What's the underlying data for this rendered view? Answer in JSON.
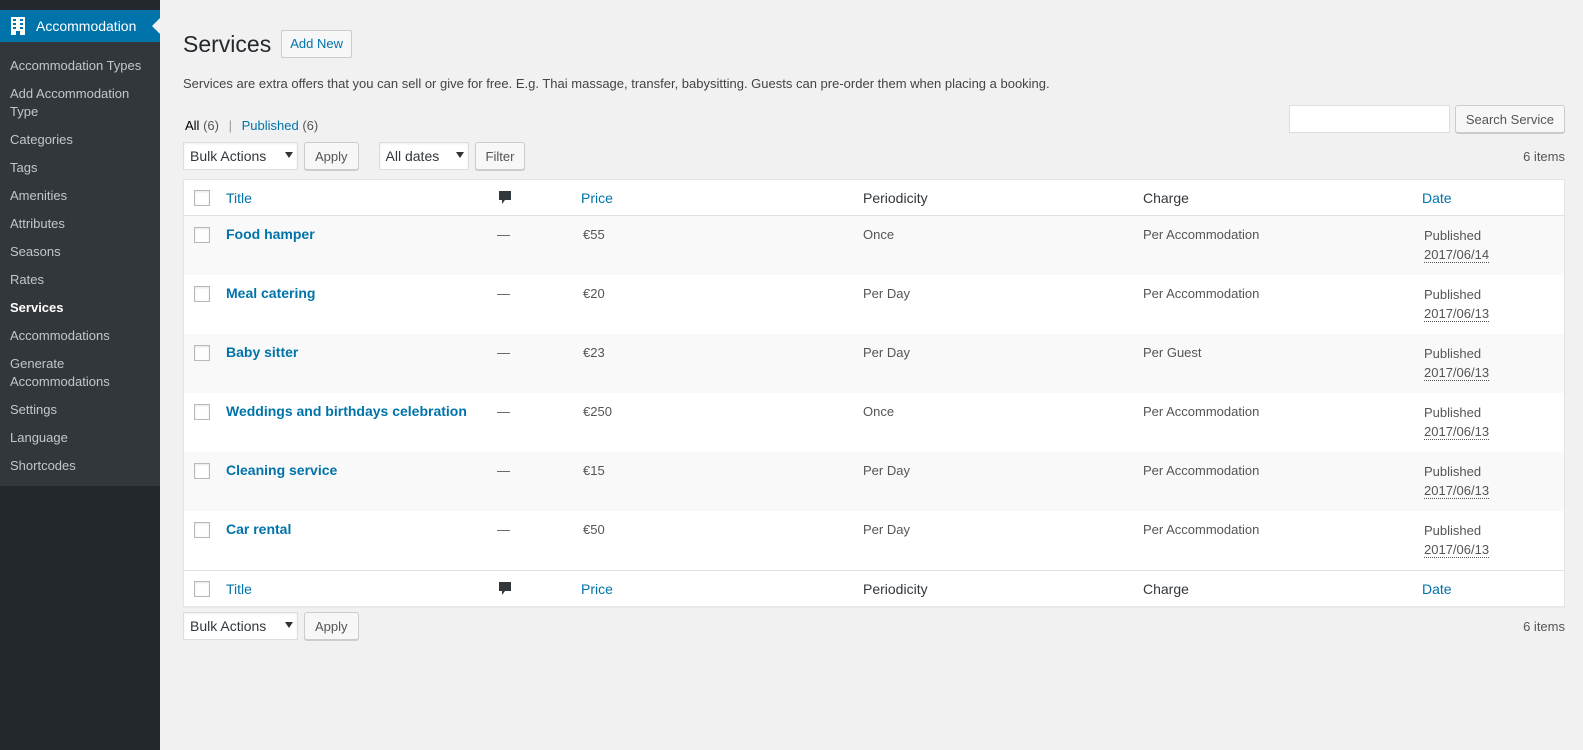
{
  "sidebar": {
    "menu_title": "Accommodation",
    "items": [
      {
        "label": "Accommodation Types",
        "current": false
      },
      {
        "label": "Add Accommodation Type",
        "current": false
      },
      {
        "label": "Categories",
        "current": false
      },
      {
        "label": "Tags",
        "current": false
      },
      {
        "label": "Amenities",
        "current": false
      },
      {
        "label": "Attributes",
        "current": false
      },
      {
        "label": "Seasons",
        "current": false
      },
      {
        "label": "Rates",
        "current": false
      },
      {
        "label": "Services",
        "current": true
      },
      {
        "label": "Accommodations",
        "current": false
      },
      {
        "label": "Generate Accommodations",
        "current": false
      },
      {
        "label": "Settings",
        "current": false
      },
      {
        "label": "Language",
        "current": false
      },
      {
        "label": "Shortcodes",
        "current": false
      }
    ]
  },
  "header": {
    "title": "Services",
    "add_new": "Add New",
    "description": "Services are extra offers that you can sell or give for free. E.g. Thai massage, transfer, babysitting. Guests can pre-order them when placing a booking."
  },
  "filters": {
    "all_label": "All",
    "all_count": "(6)",
    "separator": "|",
    "published_label": "Published",
    "published_count": "(6)"
  },
  "search": {
    "value": "",
    "button": "Search Service"
  },
  "tablenav": {
    "bulk_actions": "Bulk Actions",
    "apply": "Apply",
    "dates": "All dates",
    "filter": "Filter",
    "items_count": "6 items"
  },
  "table": {
    "columns": {
      "title": "Title",
      "comments_icon": "comment-bubble",
      "price": "Price",
      "periodicity": "Periodicity",
      "charge": "Charge",
      "date": "Date"
    },
    "rows": [
      {
        "title": "Food hamper",
        "comments": "—",
        "price": "€55",
        "periodicity": "Once",
        "charge": "Per Accommodation",
        "status": "Published",
        "date": "2017/06/14"
      },
      {
        "title": "Meal catering",
        "comments": "—",
        "price": "€20",
        "periodicity": "Per Day",
        "charge": "Per Accommodation",
        "status": "Published",
        "date": "2017/06/13"
      },
      {
        "title": "Baby sitter",
        "comments": "—",
        "price": "€23",
        "periodicity": "Per Day",
        "charge": "Per Guest",
        "status": "Published",
        "date": "2017/06/13"
      },
      {
        "title": "Weddings and birthdays celebration",
        "comments": "—",
        "price": "€250",
        "periodicity": "Once",
        "charge": "Per Accommodation",
        "status": "Published",
        "date": "2017/06/13"
      },
      {
        "title": "Cleaning service",
        "comments": "—",
        "price": "€15",
        "periodicity": "Per Day",
        "charge": "Per Accommodation",
        "status": "Published",
        "date": "2017/06/13"
      },
      {
        "title": "Car rental",
        "comments": "—",
        "price": "€50",
        "periodicity": "Per Day",
        "charge": "Per Accommodation",
        "status": "Published",
        "date": "2017/06/13"
      }
    ]
  },
  "colors": {
    "sidebar_bg": "#23282d",
    "submenu_bg": "#32373c",
    "accent": "#0073aa",
    "page_bg": "#f1f1f1"
  }
}
